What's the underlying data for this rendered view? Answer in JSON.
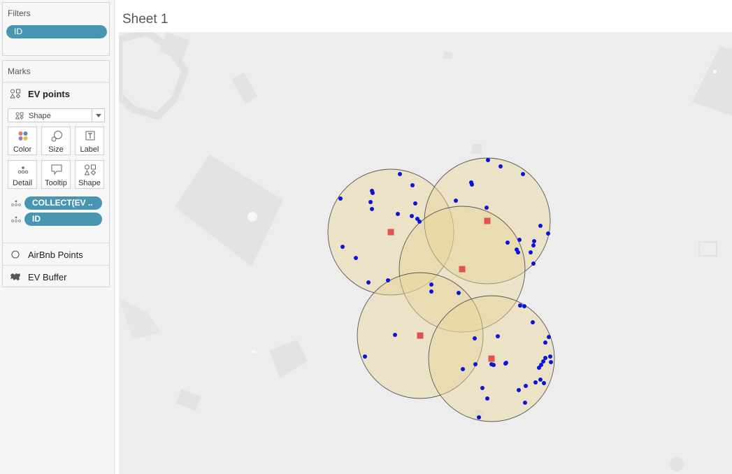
{
  "filters": {
    "title": "Filters",
    "pills": [
      "ID"
    ]
  },
  "marks": {
    "title": "Marks",
    "active_layer": "EV points",
    "mark_type": "Shape",
    "buttons": [
      "Color",
      "Size",
      "Label",
      "Detail",
      "Tooltip",
      "Shape"
    ],
    "fields": [
      "COLLECT(EV ..",
      "ID"
    ],
    "layers": [
      "AirBnb Points",
      "EV Buffer"
    ]
  },
  "sheet": {
    "title": "Sheet 1"
  },
  "colors": {
    "pill": "#4996b2",
    "buffer_fill": "#e8d49a",
    "ev_point": "#e05353",
    "airbnb_point": "#0a14d9"
  }
}
